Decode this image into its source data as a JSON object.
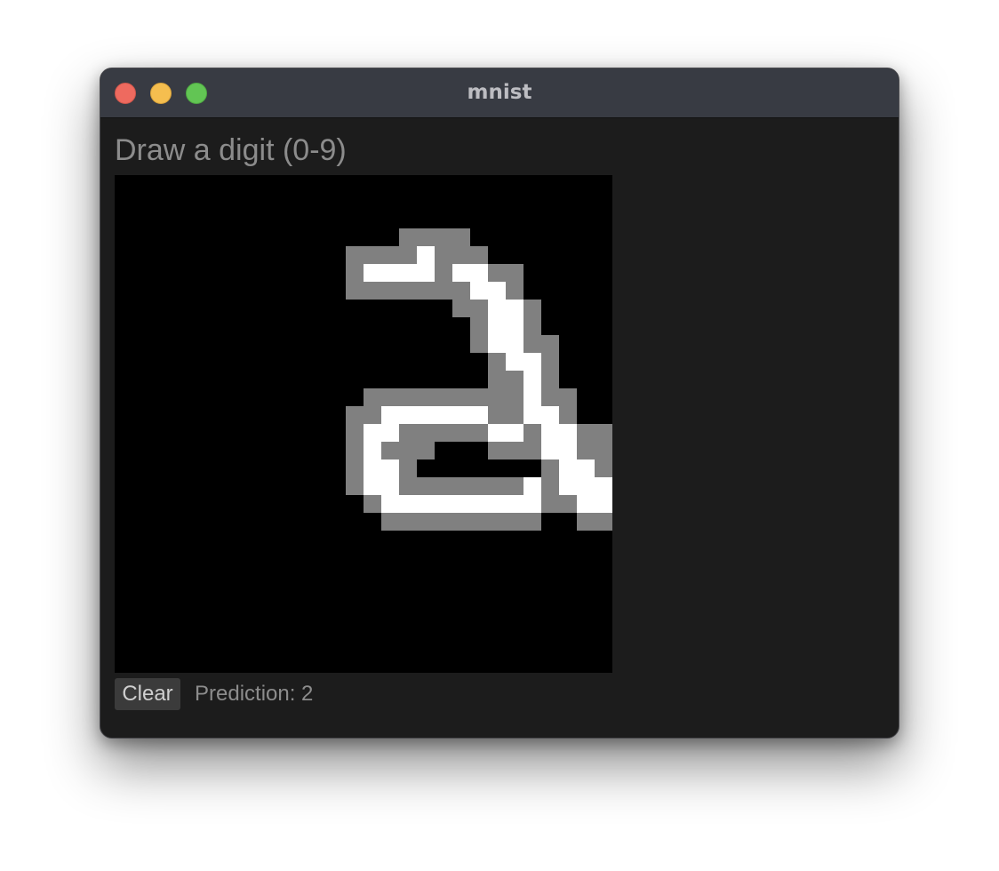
{
  "window": {
    "title": "mnist"
  },
  "app": {
    "heading": "Draw a digit (0-9)",
    "clear_label": "Clear",
    "prediction_text": "Prediction: 2"
  },
  "drawing": {
    "grid_size": 28,
    "colors": {
      "background": "#000000",
      "gray": "#808080",
      "white": "#ffffff"
    },
    "rows": [
      "............................",
      "............................",
      "............................",
      "................gggg........",
      ".............ggggwggg.......",
      ".............gwwwwgwwgg.....",
      ".............gggggggwwg.....",
      "...................ggwwg....",
      "....................gwwg....",
      "....................gwwgg...",
      ".....................gwwg...",
      ".....................ggwg...",
      "..............gggggggggwgg..",
      ".............ggwwwwwwggwwg..",
      ".............gwwgggggwwgwwgg..",
      ".............gwggg...gggwwgg.",
      ".............gwwg.......gwwggg.",
      ".............gwwgggggggwgwwwggg",
      "..............gwwwwwwwwwggwwwwg",
      "...............ggggggggg..gggg.",
      "............................",
      "............................",
      "............................",
      "............................",
      "............................",
      "............................",
      "............................",
      "............................"
    ]
  }
}
